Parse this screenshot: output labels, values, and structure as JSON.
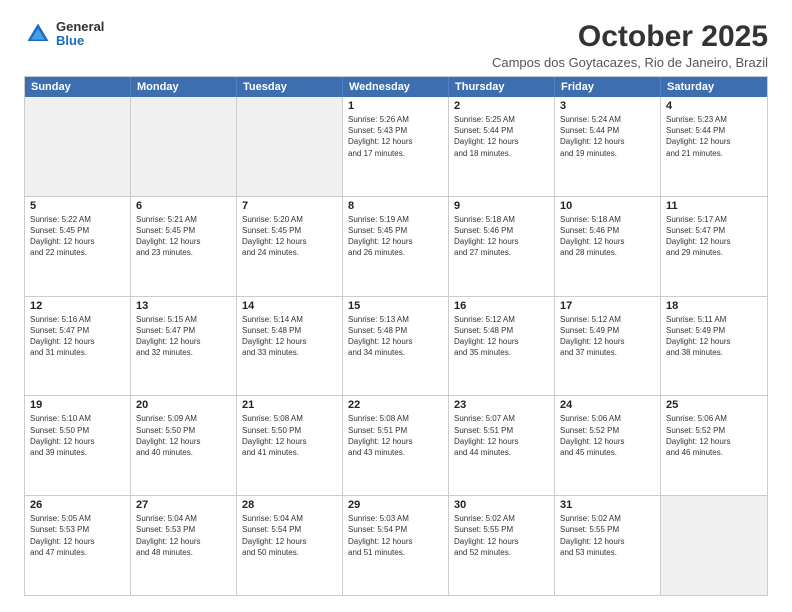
{
  "logo": {
    "general": "General",
    "blue": "Blue"
  },
  "header": {
    "month": "October 2025",
    "subtitle": "Campos dos Goytacazes, Rio de Janeiro, Brazil"
  },
  "weekdays": [
    "Sunday",
    "Monday",
    "Tuesday",
    "Wednesday",
    "Thursday",
    "Friday",
    "Saturday"
  ],
  "rows": [
    [
      {
        "day": "",
        "text": "",
        "shaded": true
      },
      {
        "day": "",
        "text": "",
        "shaded": true
      },
      {
        "day": "",
        "text": "",
        "shaded": true
      },
      {
        "day": "1",
        "text": "Sunrise: 5:26 AM\nSunset: 5:43 PM\nDaylight: 12 hours\nand 17 minutes.",
        "shaded": false
      },
      {
        "day": "2",
        "text": "Sunrise: 5:25 AM\nSunset: 5:44 PM\nDaylight: 12 hours\nand 18 minutes.",
        "shaded": false
      },
      {
        "day": "3",
        "text": "Sunrise: 5:24 AM\nSunset: 5:44 PM\nDaylight: 12 hours\nand 19 minutes.",
        "shaded": false
      },
      {
        "day": "4",
        "text": "Sunrise: 5:23 AM\nSunset: 5:44 PM\nDaylight: 12 hours\nand 21 minutes.",
        "shaded": false
      }
    ],
    [
      {
        "day": "5",
        "text": "Sunrise: 5:22 AM\nSunset: 5:45 PM\nDaylight: 12 hours\nand 22 minutes.",
        "shaded": false
      },
      {
        "day": "6",
        "text": "Sunrise: 5:21 AM\nSunset: 5:45 PM\nDaylight: 12 hours\nand 23 minutes.",
        "shaded": false
      },
      {
        "day": "7",
        "text": "Sunrise: 5:20 AM\nSunset: 5:45 PM\nDaylight: 12 hours\nand 24 minutes.",
        "shaded": false
      },
      {
        "day": "8",
        "text": "Sunrise: 5:19 AM\nSunset: 5:45 PM\nDaylight: 12 hours\nand 26 minutes.",
        "shaded": false
      },
      {
        "day": "9",
        "text": "Sunrise: 5:18 AM\nSunset: 5:46 PM\nDaylight: 12 hours\nand 27 minutes.",
        "shaded": false
      },
      {
        "day": "10",
        "text": "Sunrise: 5:18 AM\nSunset: 5:46 PM\nDaylight: 12 hours\nand 28 minutes.",
        "shaded": false
      },
      {
        "day": "11",
        "text": "Sunrise: 5:17 AM\nSunset: 5:47 PM\nDaylight: 12 hours\nand 29 minutes.",
        "shaded": false
      }
    ],
    [
      {
        "day": "12",
        "text": "Sunrise: 5:16 AM\nSunset: 5:47 PM\nDaylight: 12 hours\nand 31 minutes.",
        "shaded": false
      },
      {
        "day": "13",
        "text": "Sunrise: 5:15 AM\nSunset: 5:47 PM\nDaylight: 12 hours\nand 32 minutes.",
        "shaded": false
      },
      {
        "day": "14",
        "text": "Sunrise: 5:14 AM\nSunset: 5:48 PM\nDaylight: 12 hours\nand 33 minutes.",
        "shaded": false
      },
      {
        "day": "15",
        "text": "Sunrise: 5:13 AM\nSunset: 5:48 PM\nDaylight: 12 hours\nand 34 minutes.",
        "shaded": false
      },
      {
        "day": "16",
        "text": "Sunrise: 5:12 AM\nSunset: 5:48 PM\nDaylight: 12 hours\nand 35 minutes.",
        "shaded": false
      },
      {
        "day": "17",
        "text": "Sunrise: 5:12 AM\nSunset: 5:49 PM\nDaylight: 12 hours\nand 37 minutes.",
        "shaded": false
      },
      {
        "day": "18",
        "text": "Sunrise: 5:11 AM\nSunset: 5:49 PM\nDaylight: 12 hours\nand 38 minutes.",
        "shaded": false
      }
    ],
    [
      {
        "day": "19",
        "text": "Sunrise: 5:10 AM\nSunset: 5:50 PM\nDaylight: 12 hours\nand 39 minutes.",
        "shaded": false
      },
      {
        "day": "20",
        "text": "Sunrise: 5:09 AM\nSunset: 5:50 PM\nDaylight: 12 hours\nand 40 minutes.",
        "shaded": false
      },
      {
        "day": "21",
        "text": "Sunrise: 5:08 AM\nSunset: 5:50 PM\nDaylight: 12 hours\nand 41 minutes.",
        "shaded": false
      },
      {
        "day": "22",
        "text": "Sunrise: 5:08 AM\nSunset: 5:51 PM\nDaylight: 12 hours\nand 43 minutes.",
        "shaded": false
      },
      {
        "day": "23",
        "text": "Sunrise: 5:07 AM\nSunset: 5:51 PM\nDaylight: 12 hours\nand 44 minutes.",
        "shaded": false
      },
      {
        "day": "24",
        "text": "Sunrise: 5:06 AM\nSunset: 5:52 PM\nDaylight: 12 hours\nand 45 minutes.",
        "shaded": false
      },
      {
        "day": "25",
        "text": "Sunrise: 5:06 AM\nSunset: 5:52 PM\nDaylight: 12 hours\nand 46 minutes.",
        "shaded": false
      }
    ],
    [
      {
        "day": "26",
        "text": "Sunrise: 5:05 AM\nSunset: 5:53 PM\nDaylight: 12 hours\nand 47 minutes.",
        "shaded": false
      },
      {
        "day": "27",
        "text": "Sunrise: 5:04 AM\nSunset: 5:53 PM\nDaylight: 12 hours\nand 48 minutes.",
        "shaded": false
      },
      {
        "day": "28",
        "text": "Sunrise: 5:04 AM\nSunset: 5:54 PM\nDaylight: 12 hours\nand 50 minutes.",
        "shaded": false
      },
      {
        "day": "29",
        "text": "Sunrise: 5:03 AM\nSunset: 5:54 PM\nDaylight: 12 hours\nand 51 minutes.",
        "shaded": false
      },
      {
        "day": "30",
        "text": "Sunrise: 5:02 AM\nSunset: 5:55 PM\nDaylight: 12 hours\nand 52 minutes.",
        "shaded": false
      },
      {
        "day": "31",
        "text": "Sunrise: 5:02 AM\nSunset: 5:55 PM\nDaylight: 12 hours\nand 53 minutes.",
        "shaded": false
      },
      {
        "day": "",
        "text": "",
        "shaded": true
      }
    ]
  ]
}
